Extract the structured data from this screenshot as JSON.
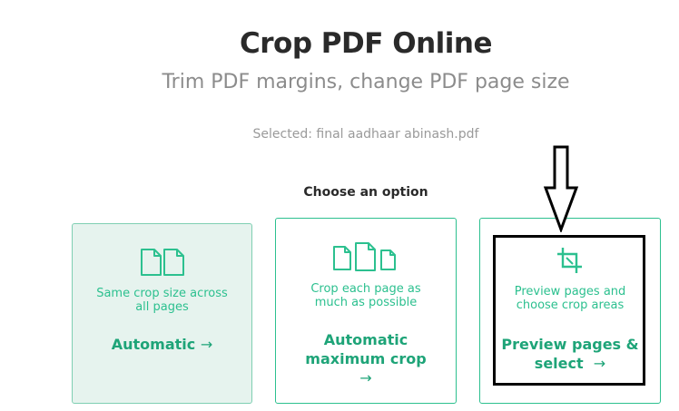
{
  "header": {
    "title": "Crop PDF Online",
    "subtitle": "Trim PDF margins, change PDF page size",
    "selected": "Selected: final aadhaar abinash.pdf"
  },
  "options_heading": "Choose an option",
  "options": [
    {
      "description_line1": "Same crop size across",
      "description_line2": "all pages",
      "action_line1": "Automatic",
      "action_arrow": "→",
      "icon": "two-pages-icon"
    },
    {
      "description_line1": "Crop each page as",
      "description_line2": "much as possible",
      "action_line1": "Automatic",
      "action_line2": "maximum crop",
      "action_arrow": "→",
      "icon": "three-pages-icon"
    },
    {
      "description_line1": "Preview pages and",
      "description_line2": "choose crop areas",
      "action_line1": "Preview pages &",
      "action_line2": "select",
      "action_arrow": "→",
      "icon": "crop-icon"
    }
  ],
  "colors": {
    "accent": "#2cc08f",
    "accent_dark": "#1ea478",
    "active_bg": "#e6f3ee",
    "annotation": "#000000"
  }
}
